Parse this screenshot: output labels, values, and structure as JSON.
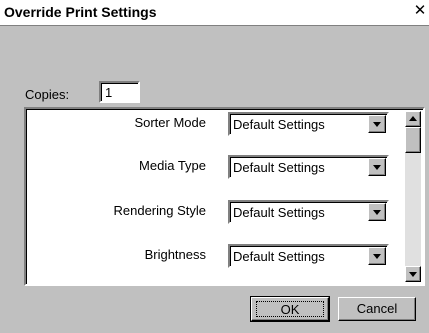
{
  "window": {
    "title": "Override Print Settings",
    "close_glyph": "✕"
  },
  "copies": {
    "label": "Copies:",
    "value": "1"
  },
  "settings": [
    {
      "label": "Sorter Mode",
      "value": "Default Settings"
    },
    {
      "label": "Media Type",
      "value": "Default Settings"
    },
    {
      "label": "Rendering Style",
      "value": "Default Settings"
    },
    {
      "label": "Brightness",
      "value": "Default Settings"
    }
  ],
  "buttons": {
    "ok_label": "OK",
    "cancel_label": "Cancel"
  },
  "icons": {
    "close": "close-icon",
    "dropdown": "chevron-down-icon",
    "scroll_up": "scroll-up-arrow-icon",
    "scroll_down": "scroll-down-arrow-icon"
  },
  "colors": {
    "face": "#c0c0c0",
    "titlebar": "#ffffff",
    "field": "#ffffff"
  }
}
